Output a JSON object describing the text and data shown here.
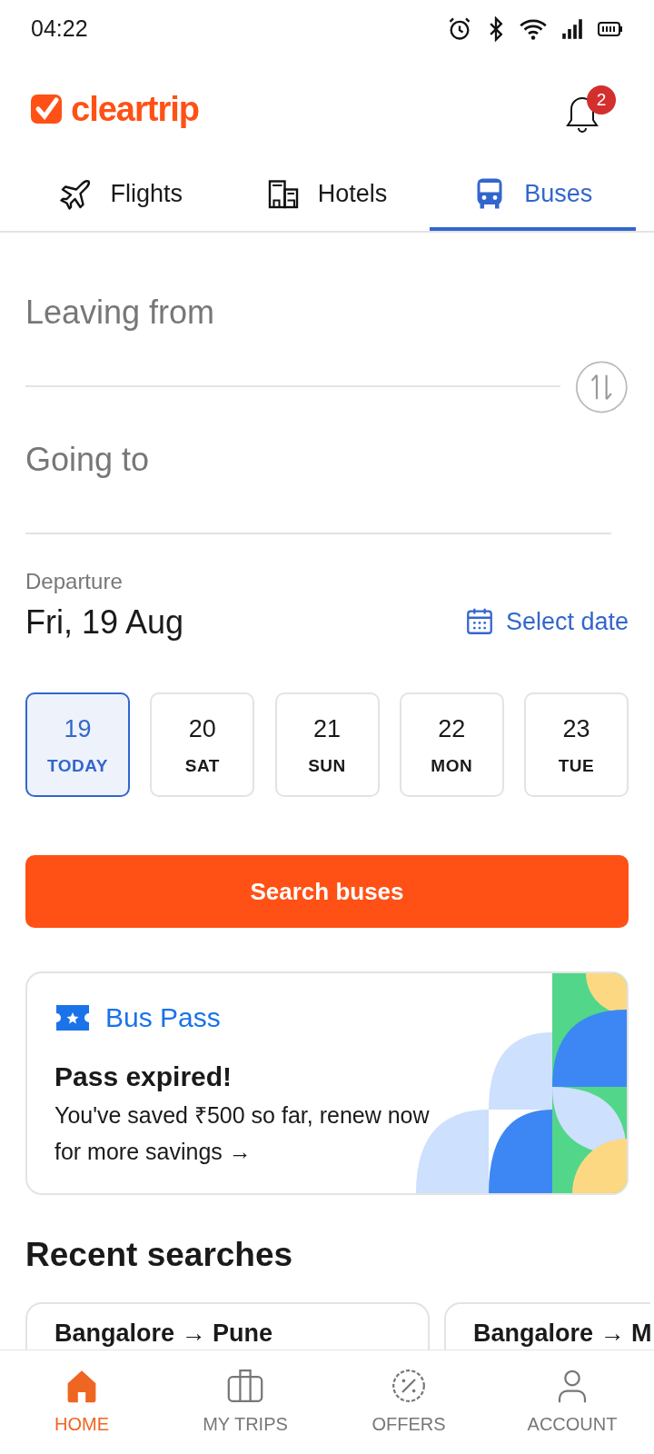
{
  "status_bar": {
    "time": "04:22"
  },
  "header": {
    "logo": "cleartrip",
    "notifications": "2"
  },
  "tabs": [
    {
      "label": "Flights",
      "kind": "plane",
      "selected": false
    },
    {
      "label": "Hotels",
      "kind": "building",
      "selected": false
    },
    {
      "label": "Buses",
      "kind": "bus",
      "selected": true
    }
  ],
  "search": {
    "from_placeholder": "Leaving from",
    "to_placeholder": "Going to"
  },
  "departure": {
    "label": "Departure",
    "date": "Fri, 19 Aug",
    "select_link": "Select date"
  },
  "dates": [
    {
      "day": "19",
      "weekday": "TODAY",
      "selected": true
    },
    {
      "day": "20",
      "weekday": "SAT",
      "selected": false
    },
    {
      "day": "21",
      "weekday": "SUN",
      "selected": false
    },
    {
      "day": "22",
      "weekday": "MON",
      "selected": false
    },
    {
      "day": "23",
      "weekday": "TUE",
      "selected": false
    }
  ],
  "search_button": "Search buses",
  "bus_pass": {
    "title": "Bus Pass",
    "heading": "Pass expired!",
    "text": "You've saved ₹500 so far, renew now for more savings →"
  },
  "recent_searches": {
    "title": "Recent searches",
    "items": [
      "Bangalore → Pune",
      "Bangalore → M"
    ]
  },
  "bottom_nav": [
    {
      "label": "HOME",
      "kind": "home",
      "selected": true
    },
    {
      "label": "MY TRIPS",
      "kind": "trips",
      "selected": false
    },
    {
      "label": "OFFERS",
      "kind": "offers",
      "selected": false
    },
    {
      "label": "ACCOUNT",
      "kind": "account",
      "selected": false
    }
  ]
}
